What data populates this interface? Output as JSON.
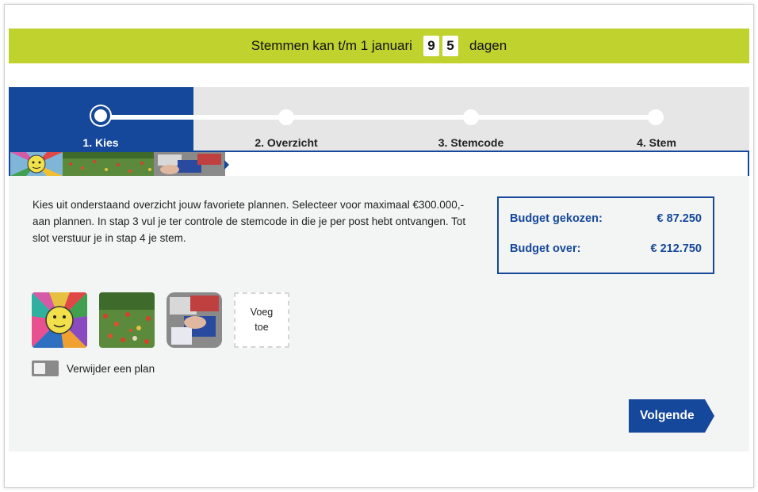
{
  "banner": {
    "text_before": "Stemmen kan t/m 1 januari",
    "digits": [
      "9",
      "5"
    ],
    "text_after": "dagen"
  },
  "steps": [
    {
      "label": "1. Kies",
      "active": true
    },
    {
      "label": "2. Overzicht",
      "active": false
    },
    {
      "label": "3. Stemcode",
      "active": false
    },
    {
      "label": "4. Stem",
      "active": false
    }
  ],
  "intro": "Kies uit onderstaand overzicht jouw favoriete plannen. Selecteer voor maximaal €300.000,- aan plannen. In stap 3 vul je ter controle de stemcode in die je per post hebt ontvangen. Tot slot verstuur je in stap 4 je stem.",
  "budget": {
    "chosen_label": "Budget gekozen:",
    "chosen_value": "€ 87.250",
    "left_label": "Budget over:",
    "left_value": "€ 212.750"
  },
  "selected_plans": [
    "sun-drawing-image",
    "flower-field-image",
    "clothes-pile-image"
  ],
  "add_tile": {
    "line1": "Voeg",
    "line2": "toe"
  },
  "toggle": {
    "label": "Verwijder een plan"
  },
  "next_button": {
    "label": "Volgende"
  },
  "colors": {
    "brand_blue": "#15479a",
    "banner_green": "#bfd22e",
    "panel_bg": "#f3f5f4"
  }
}
